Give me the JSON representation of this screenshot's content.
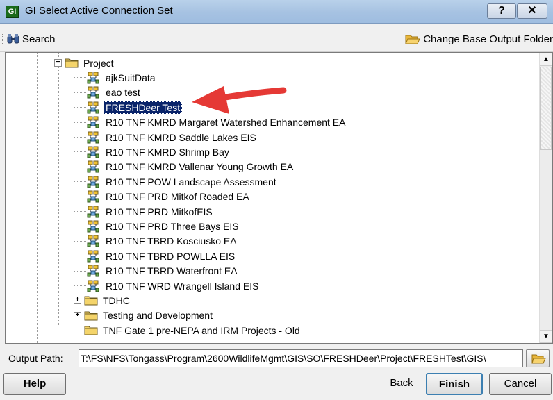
{
  "window": {
    "title": "GI Select Active Connection Set",
    "app_icon_glyph": "GI",
    "help_glyph": "?",
    "close_glyph": "✕"
  },
  "toolbar": {
    "search_label": "Search",
    "change_folder_label": "Change Base Output Folder"
  },
  "tree": {
    "root_label": "Project",
    "items": [
      {
        "label": "ajkSuitData"
      },
      {
        "label": "eao test"
      },
      {
        "label": "FRESHDeer Test",
        "selected": true
      },
      {
        "label": "R10 TNF KMRD Margaret Watershed Enhancement EA"
      },
      {
        "label": "R10 TNF KMRD Saddle Lakes EIS"
      },
      {
        "label": "R10 TNF KMRD Shrimp Bay"
      },
      {
        "label": "R10 TNF KMRD Vallenar Young Growth EA"
      },
      {
        "label": "R10 TNF POW Landscape Assessment"
      },
      {
        "label": "R10 TNF PRD Mitkof Roaded EA"
      },
      {
        "label": "R10 TNF PRD MitkofEIS"
      },
      {
        "label": "R10 TNF PRD Three Bays EIS"
      },
      {
        "label": "R10 TNF TBRD Kosciusko EA"
      },
      {
        "label": "R10 TNF TBRD POWLLA EIS"
      },
      {
        "label": "R10 TNF TBRD Waterfront EA"
      },
      {
        "label": "R10 TNF WRD Wrangell Island EIS"
      }
    ],
    "sibling_folders": [
      {
        "label": "TDHC",
        "expander": "+"
      },
      {
        "label": "Testing and Development",
        "expander": "+"
      },
      {
        "label": "TNF Gate 1 pre-NEPA and IRM Projects - Old",
        "expander": ""
      }
    ],
    "root_expander": "−"
  },
  "output": {
    "label": "Output Path:",
    "value": "T:\\FS\\NFS\\Tongass\\Program\\2600WildlifeMgmt\\GIS\\SO\\FRESHDeer\\Project\\FRESHTest\\GIS\\"
  },
  "buttons": {
    "help": "Help",
    "back": "Back",
    "finish": "Finish",
    "cancel": "Cancel"
  },
  "colors": {
    "selection": "#0a246a",
    "arrow": "#e53935",
    "folder": "#f4d46a"
  }
}
